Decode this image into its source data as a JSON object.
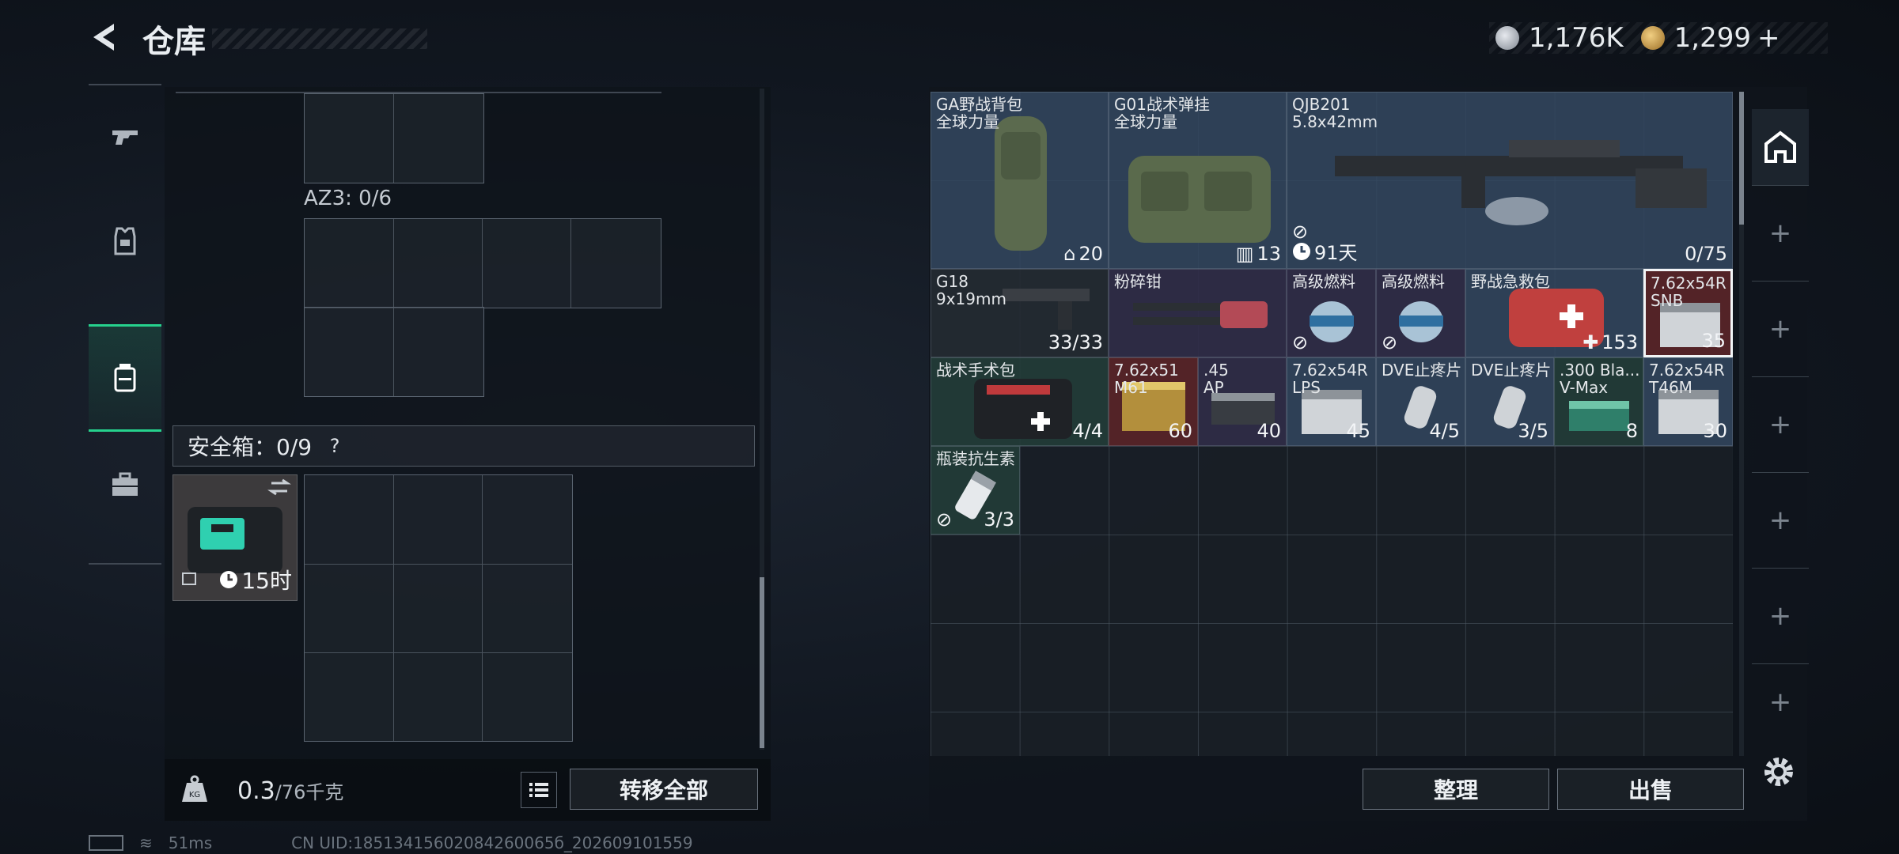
{
  "header": {
    "title": "仓库",
    "currency": [
      {
        "icon": "silver-coin-icon",
        "value": "1,176K"
      },
      {
        "icon": "gold-coin-icon",
        "value": "1,299",
        "suffix": "+"
      }
    ]
  },
  "rail": {
    "items": [
      {
        "icon": "pistol-icon"
      },
      {
        "icon": "armor-vest-icon"
      },
      {
        "icon": "backpack-icon",
        "active": true
      },
      {
        "icon": "toolbox-icon"
      }
    ]
  },
  "left": {
    "az_label": "AZ3: 0/6",
    "safe_label": "安全箱：0/9",
    "safe_help": "?",
    "safe_time": "15时",
    "weight_value": "0.3",
    "weight_max": "/76千克",
    "transfer_all": "转移全部"
  },
  "status": {
    "ping": "51ms",
    "uid": "CN UID:18513415602084260065б_202609101559"
  },
  "inventory": {
    "items": [
      {
        "name": "GA野战背包\n全球力量",
        "qty": "20"
      },
      {
        "name": "G01战术弹挂\n全球力量",
        "qty": "13"
      },
      {
        "name": "QJB201\n5.8x42mm",
        "qty": "0/75",
        "timer": "91天"
      },
      {
        "name": "G18\n9x19mm",
        "qty": "33/33"
      },
      {
        "name": "粉碎钳",
        "qty": ""
      },
      {
        "name": "高级燃料",
        "qty": ""
      },
      {
        "name": "高级燃料",
        "qty": ""
      },
      {
        "name": "野战急救包",
        "qty": "153"
      },
      {
        "name": "7.62x54R\nSNB",
        "qty": "35"
      },
      {
        "name": "战术手术包",
        "qty": "4/4"
      },
      {
        "name": "7.62x51\nM61",
        "qty": "60"
      },
      {
        "name": ".45\nAP",
        "qty": "40"
      },
      {
        "name": "7.62x54R\nLPS",
        "qty": "45"
      },
      {
        "name": "DVE止疼片",
        "qty": "4/5"
      },
      {
        "name": "DVE止疼片",
        "qty": "3/5"
      },
      {
        "name": ".300 Bla...\nV-Max",
        "qty": "8"
      },
      {
        "name": "7.62x54R\nT46M",
        "qty": "30"
      },
      {
        "name": "瓶装抗生素",
        "qty": "3/3"
      }
    ]
  },
  "actions": {
    "sort": "整理",
    "sell": "出售"
  }
}
